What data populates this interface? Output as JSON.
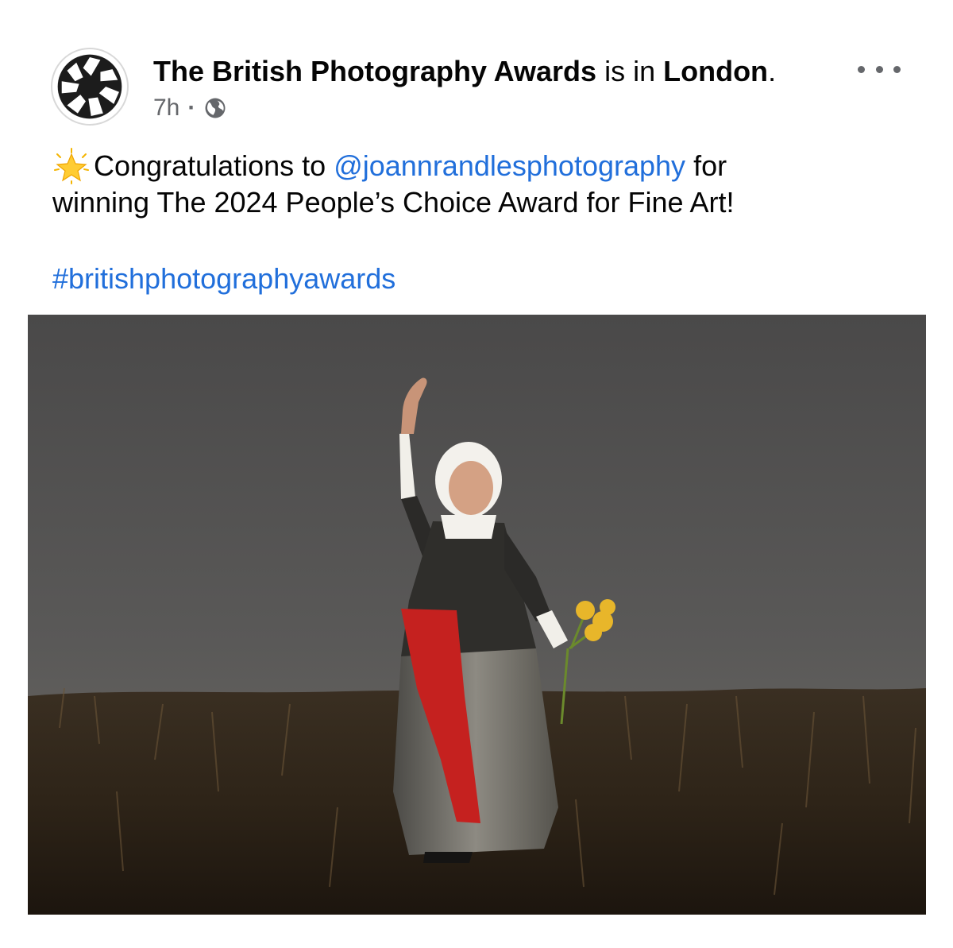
{
  "post": {
    "author_name": "The British Photography Awards",
    "location_connector": " is in ",
    "location": "London",
    "location_end": ".",
    "timestamp": "7h",
    "meta_separator": "·",
    "audience_icon": "globe-icon",
    "more_icon": "more-options-icon"
  },
  "message": {
    "emoji": "glowing-star-icon",
    "line1_prefix": "Congratulations to ",
    "mention": "@joannrandlesphotography",
    "line1_suffix": " for",
    "line2": "winning The 2024 People’s Choice Award for Fine Art!",
    "hashtag": "#britishphotographyawards"
  },
  "colors": {
    "link": "#216fdb",
    "secondary_text": "#65676b",
    "primary_text": "#050505"
  }
}
